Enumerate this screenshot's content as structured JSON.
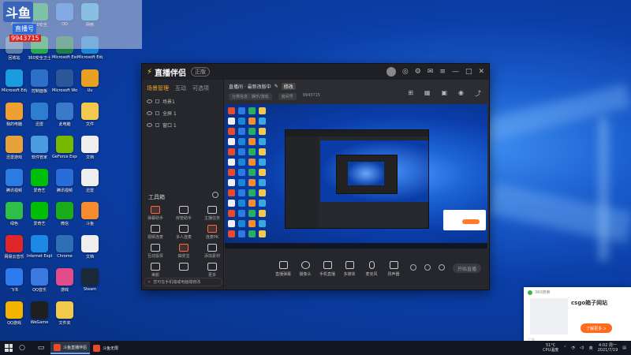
{
  "webcam": {
    "logo_text": "斗鱼",
    "channel_label": "直播号",
    "room_number": "9943715"
  },
  "desktop_icons": [
    {
      "label": "Aiu",
      "color": "#c0392b"
    },
    {
      "label": "360安全",
      "color": "#27ae60"
    },
    {
      "label": "QQ",
      "color": "#2d7be5"
    },
    {
      "label": "网络",
      "color": "#3aa8e0"
    },
    {
      "label": "回收站",
      "color": "#5a7fa8"
    },
    {
      "label": "360安全卫士",
      "color": "#2aa84e"
    },
    {
      "label": "Microsoft Excel",
      "color": "#1e7e45"
    },
    {
      "label": "Microsoft Edge",
      "color": "#1b86d6"
    },
    {
      "label": "Microsoft Edge",
      "color": "#1b9be0"
    },
    {
      "label": "控制面板",
      "color": "#2d70c9"
    },
    {
      "label": "Microsoft Word",
      "color": "#2b579a"
    },
    {
      "label": "Uu",
      "color": "#e8a020"
    },
    {
      "label": "我的电脑",
      "color": "#f0a030"
    },
    {
      "label": "迅雷",
      "color": "#2c7fd0"
    },
    {
      "label": "此电脑",
      "color": "#3a78c9"
    },
    {
      "label": "文件",
      "color": "#f2c94c"
    },
    {
      "label": "迅雷游戏",
      "color": "#e7a23a"
    },
    {
      "label": "软件管家",
      "color": "#4a9be0"
    },
    {
      "label": "GeForce Experience",
      "color": "#76b900"
    },
    {
      "label": "文档",
      "color": "#eeeeee"
    },
    {
      "label": "腾讯视频",
      "color": "#2b7be0"
    },
    {
      "label": "爱奇艺",
      "color": "#00be06"
    },
    {
      "label": "腾讯视频",
      "color": "#2a6cd8"
    },
    {
      "label": "迅雷",
      "color": "#eeeeee"
    },
    {
      "label": "绿色",
      "color": "#2dbf4a"
    },
    {
      "label": "爱奇艺",
      "color": "#00be06"
    },
    {
      "label": "微信",
      "color": "#1aad19"
    },
    {
      "label": "斗鱼",
      "color": "#f58c2d"
    },
    {
      "label": "网易云音乐",
      "color": "#e0262a"
    },
    {
      "label": "Internet Explorer",
      "color": "#1e88e5"
    },
    {
      "label": "Chrome",
      "color": "#2f6fb7"
    },
    {
      "label": "文档",
      "color": "#eeeeee"
    },
    {
      "label": "飞书",
      "color": "#2e7bf0"
    },
    {
      "label": "QQ音乐",
      "color": "#3b7be0"
    },
    {
      "label": "游戏",
      "color": "#e34c8b"
    },
    {
      "label": "Steam",
      "color": "#1b2838"
    },
    {
      "label": "QQ游戏",
      "color": "#f4b400"
    },
    {
      "label": "WeGame",
      "color": "#1f1f1f"
    },
    {
      "label": "文件夹",
      "color": "#f2c94c"
    }
  ],
  "app": {
    "name": "直播伴侣",
    "version_badge": "正版",
    "tabs": [
      "场景管理",
      "互动",
      "可选项"
    ],
    "scenes": [
      "场景1",
      "全屏 1",
      "窗口 1"
    ],
    "toolbox_title": "工具箱",
    "tools": [
      {
        "label": "弹幕助手",
        "orange": true
      },
      {
        "label": "房管助手",
        "orange": false
      },
      {
        "label": "主播任务",
        "orange": false
      },
      {
        "label": "视频连麦",
        "orange": false
      },
      {
        "label": "多人连麦",
        "orange": false
      },
      {
        "label": "连麦PK",
        "orange": true
      },
      {
        "label": "互动投票",
        "orange": false
      },
      {
        "label": "抽奖宝",
        "orange": true
      },
      {
        "label": "添加素材",
        "orange": false
      },
      {
        "label": "美颜",
        "orange": false
      },
      {
        "label": "",
        "orange": false
      },
      {
        "label": "更多",
        "orange": false
      }
    ],
    "tip_text": "您可在手机端或电脑端修改",
    "room_title": "直播间 · 最新改版中",
    "room_tag": "修改",
    "room_sub": [
      "分类信息：娱乐/游戏",
      "房间号",
      "9943715"
    ],
    "controls": [
      "直播弹幕",
      "摄像头",
      "手机直播",
      "多媒体",
      "麦克风",
      "扬声器"
    ],
    "start_label": "开始直播"
  },
  "ad": {
    "source": "360搜索",
    "title": "csgo箱子网站",
    "button": "了解更多 >",
    "footer": "广告"
  },
  "taskbar": {
    "apps": [
      {
        "label": "斗鱼直播伴侣",
        "active": true
      },
      {
        "label": "斗鱼无限",
        "active": false
      }
    ],
    "weather_temp": "51°C",
    "weather_label": "CPU温度",
    "time": "4:02 周一",
    "date": "2021/7/19"
  }
}
